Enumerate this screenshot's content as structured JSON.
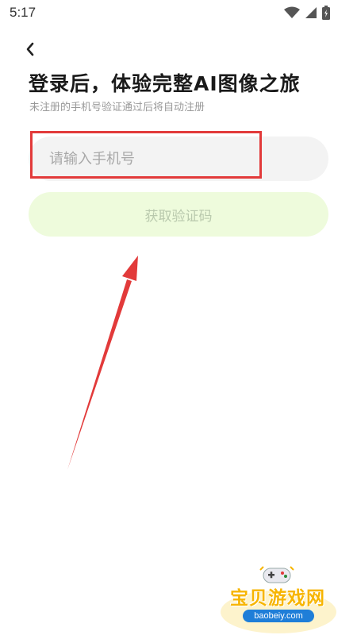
{
  "status_bar": {
    "time": "5:17",
    "icons": [
      "wifi-icon",
      "signal-icon",
      "battery-icon"
    ]
  },
  "header": {
    "back_icon": "chevron-left-icon"
  },
  "login": {
    "title": "登录后，体验完整AI图像之旅",
    "subtitle": "未注册的手机号验证通过后将自动注册",
    "phone_placeholder": "请输入手机号",
    "phone_value": "",
    "get_code_label": "获取验证码"
  },
  "annotation": {
    "highlight_color": "#e23a3a",
    "arrow_color": "#e23a3a"
  },
  "watermark": {
    "text": "宝贝游戏网",
    "url": "baobeiy.com",
    "icon": "gamepad-icon"
  },
  "colors": {
    "button_bg": "#eefbdc",
    "button_text": "#b9c9ad",
    "field_bg": "#f3f3f3"
  }
}
